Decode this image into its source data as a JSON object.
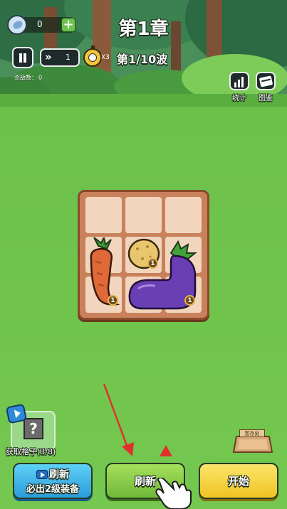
{
  "hud": {
    "gems": "0",
    "speed": "1",
    "time_multiplier": "X3",
    "kills_label": "杀敌数：",
    "kills_value": "0"
  },
  "chapter": {
    "title": "第1章",
    "wave": "第1/10波"
  },
  "side_buttons": {
    "stats": "统计",
    "codex": "图鉴"
  },
  "board": {
    "items": [
      {
        "name": "carrot",
        "level": "1"
      },
      {
        "name": "potato",
        "level": "1"
      },
      {
        "name": "eggplant",
        "level": "1"
      }
    ]
  },
  "bottom": {
    "grid_label": "获取格子(3/8)",
    "storage_label": "暂存处",
    "refresh_ad_line1": "刷新",
    "refresh_ad_line2": "必出2级装备",
    "refresh_label": "刷新",
    "start_label": "开始"
  },
  "colors": {
    "blue_button": "#35b4e8",
    "green_button": "#8ed044",
    "yellow_button": "#f6d53c",
    "tutorial_arrow": "#e0312a"
  }
}
